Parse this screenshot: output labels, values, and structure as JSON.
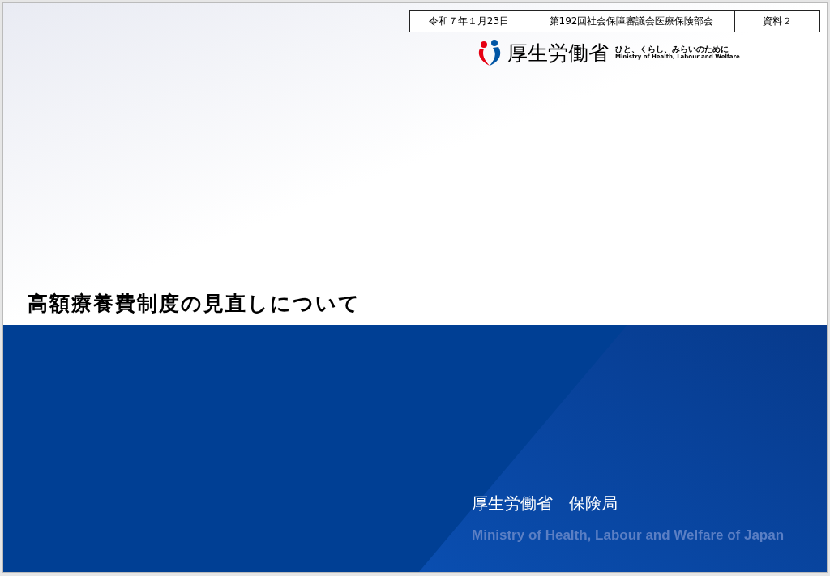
{
  "header_table": {
    "cells": [
      "令和７年１月23日",
      "第192回社会保障審議会医療保険部会",
      "資料２"
    ]
  },
  "logo": {
    "name": "厚生労働省",
    "tagline": "ひと、くらし、みらいのために",
    "english": "Ministry of Health, Labour and Welfare"
  },
  "title": "高額療養費制度の見直しについて",
  "footer": {
    "organization": "厚生労働省　保険局",
    "english": "Ministry of Health, Labour and Welfare of Japan"
  }
}
